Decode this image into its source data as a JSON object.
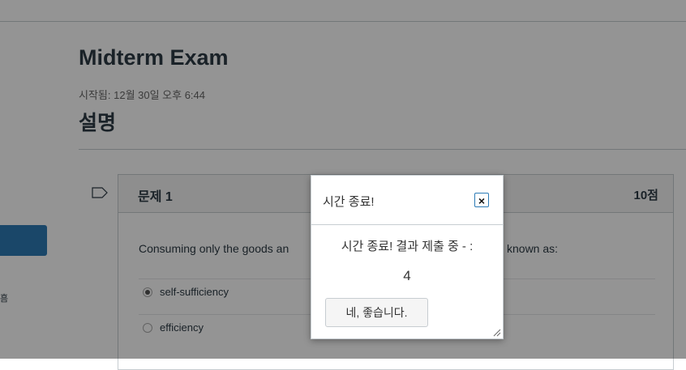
{
  "page": {
    "title": "Midterm Exam",
    "started": "시작됨: 12월 30일 오후 6:44",
    "section": "설명",
    "left_glyph": "흠"
  },
  "question": {
    "flag_icon": "flag-outline-icon",
    "title": "문제 1",
    "points": "10점",
    "text_start": "Consuming only the goods an",
    "text_end": "known as:",
    "options": [
      {
        "label": "self-sufficiency",
        "selected": true
      },
      {
        "label": "efficiency",
        "selected": false
      }
    ]
  },
  "dialog": {
    "title": "시간 종료!",
    "close_label": "×",
    "message": "시간 종료! 결과 제출 중 - :",
    "countdown": "4",
    "confirm_label": "네, 좋습니다.",
    "resize_icon": "resize-grip-icon"
  },
  "colors": {
    "accent": "#2d7bb6",
    "overlay": "rgba(0,0,0,0.42)"
  }
}
